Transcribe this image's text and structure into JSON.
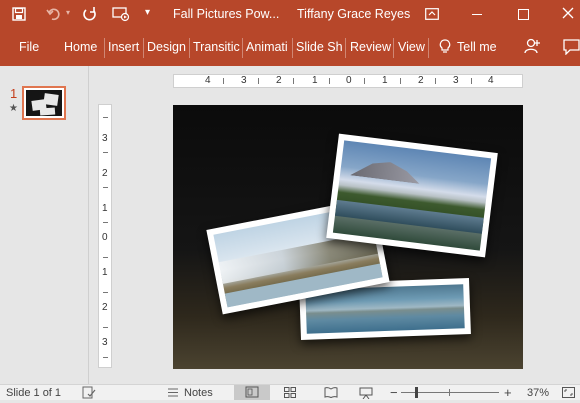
{
  "titlebar": {
    "doc_title": "Fall Pictures Pow...",
    "user_name": "Tiffany Grace Reyes",
    "icons": [
      "save-icon",
      "undo-icon",
      "redo-icon",
      "present-icon",
      "customize-qat-icon",
      "ribbon-display-icon",
      "minimize-icon",
      "maximize-icon",
      "close-icon"
    ]
  },
  "ribbon": {
    "tabs": [
      "File",
      "Home",
      "Insert",
      "Design",
      "Transitic",
      "Animati",
      "Slide Sh",
      "Review",
      "View"
    ],
    "tell_me": "Tell me",
    "icons": [
      "lightbulb-icon",
      "share-icon",
      "comment-icon"
    ]
  },
  "slides_pane": {
    "number": "1",
    "star": "★"
  },
  "ruler": {
    "horizontal": [
      "4",
      "3",
      "2",
      "1",
      "0",
      "1",
      "2",
      "3",
      "4"
    ],
    "vertical": [
      "3",
      "2",
      "1",
      "0",
      "1",
      "2",
      "3"
    ]
  },
  "statusbar": {
    "slide_info": "Slide 1 of 1",
    "notes_label": "Notes",
    "minus": "−",
    "plus": "+",
    "zoom": "37%"
  },
  "colors": {
    "accent": "#b7472a",
    "thumb_border": "#e0754f"
  }
}
